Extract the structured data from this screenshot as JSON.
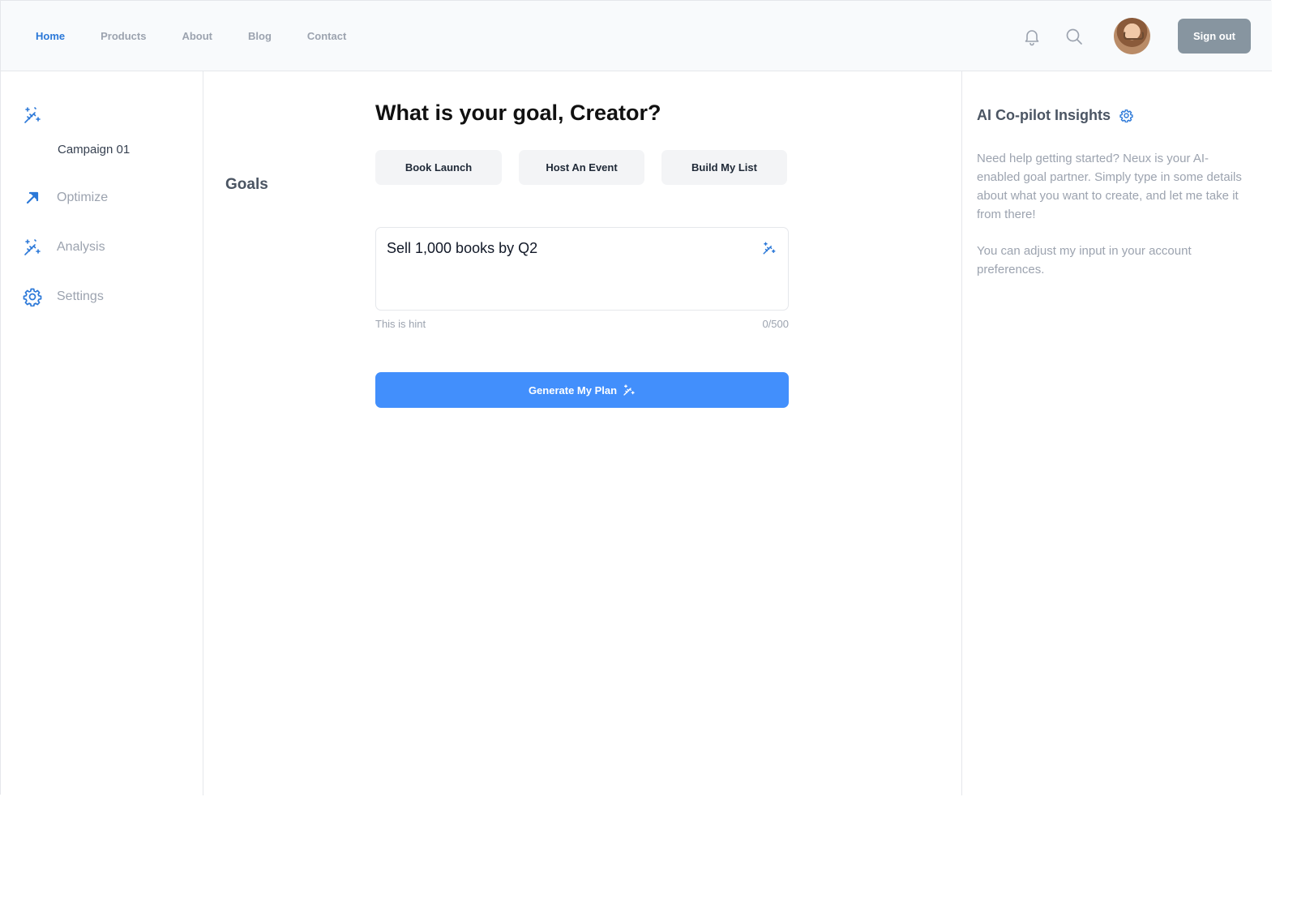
{
  "nav": {
    "links": [
      {
        "label": "Home",
        "active": true
      },
      {
        "label": "Products",
        "active": false
      },
      {
        "label": "About",
        "active": false
      },
      {
        "label": "Blog",
        "active": false
      },
      {
        "label": "Contact",
        "active": false
      }
    ],
    "icons": {
      "notifications": "bell-icon",
      "search": "search-icon"
    },
    "signout_label": "Sign out"
  },
  "sidebar": {
    "goals": {
      "label": "Goals",
      "icon": "magic-wand-icon"
    },
    "campaign": "Campaign 01",
    "items": [
      {
        "label": "Optimize",
        "icon": "arrow-up-right-icon"
      },
      {
        "label": "Analysis",
        "icon": "magic-wand-icon"
      },
      {
        "label": "Settings",
        "icon": "gear-icon"
      }
    ]
  },
  "main": {
    "title": "What is your goal, Creator?",
    "chips": [
      "Book Launch",
      "Host An Event",
      "Build My List"
    ],
    "goal_input": {
      "value": "Sell 1,000 books by Q2"
    },
    "hint": "This is hint",
    "counter": "0/500",
    "generate_label": "Generate My Plan"
  },
  "insights": {
    "title": "AI Co-pilot Insights",
    "paragraphs": [
      "Need help getting started? Neux is your AI-enabled goal partner. Simply type in some details about what you want to create, and let me take it from there!",
      "You can adjust my input in your account preferences."
    ]
  },
  "colors": {
    "accent": "#2b78d8",
    "primary_button": "#428ffc",
    "signout_button": "#8795a0",
    "chip_bg": "#f3f4f6"
  }
}
